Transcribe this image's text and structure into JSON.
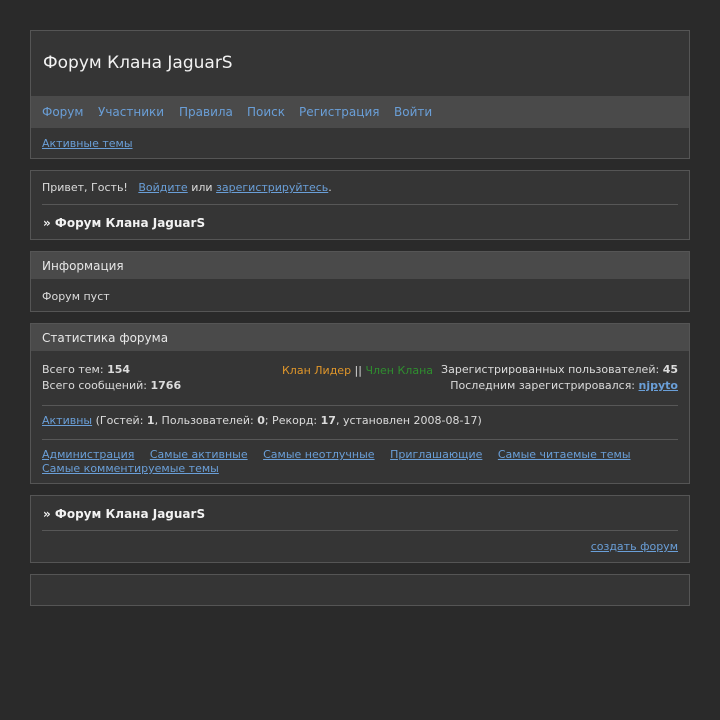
{
  "header": {
    "title": "Форум Клана JaguarS",
    "nav": [
      "Форум",
      "Участники",
      "Правила",
      "Поиск",
      "Регистрация",
      "Войти"
    ],
    "active_topics": "Активные темы"
  },
  "welcome": {
    "greeting": "Привет, Гость!",
    "login_link": "Войдите",
    "or_text": "или",
    "register_link": "зарегистрируйтесь",
    "period": ".",
    "breadcrumb": "» Форум Клана JaguarS"
  },
  "info": {
    "heading": "Информация",
    "text": "Форум пуст"
  },
  "stats": {
    "heading": "Статистика форума",
    "topics_label": "Всего тем:",
    "topics_value": "154",
    "posts_label": "Всего сообщений:",
    "posts_value": "1766",
    "legend_leader": "Клан Лидер",
    "legend_sep": "||",
    "legend_member": "Член Клана",
    "registered_label": "Зарегистрированных пользователей:",
    "registered_value": "45",
    "last_registered_label": "Последним зарегистрировался:",
    "last_registered_user": "njpyto",
    "online_link": "Активны",
    "online_guests_label": "(Гостей:",
    "online_guests": "1",
    "online_users_label": ", Пользователей:",
    "online_users": "0",
    "online_record_label": "; Рекорд:",
    "online_record": "17",
    "online_record_date": ", установлен 2008-08-17)",
    "links": [
      "Администрация",
      "Самые активные",
      "Самые неотлучные",
      "Приглашающие",
      "Самые читаемые темы",
      "Самые комментируемые темы"
    ]
  },
  "forum_section": {
    "breadcrumb": "» Форум Клана JaguarS",
    "create_link": "создать форум"
  },
  "colors": {
    "background": "#2a2a2a",
    "panel": "#353535",
    "panel_header": "#4a4a4a",
    "link": "#6a9fd8",
    "leader": "#e0962a",
    "member": "#2f8f2f"
  }
}
